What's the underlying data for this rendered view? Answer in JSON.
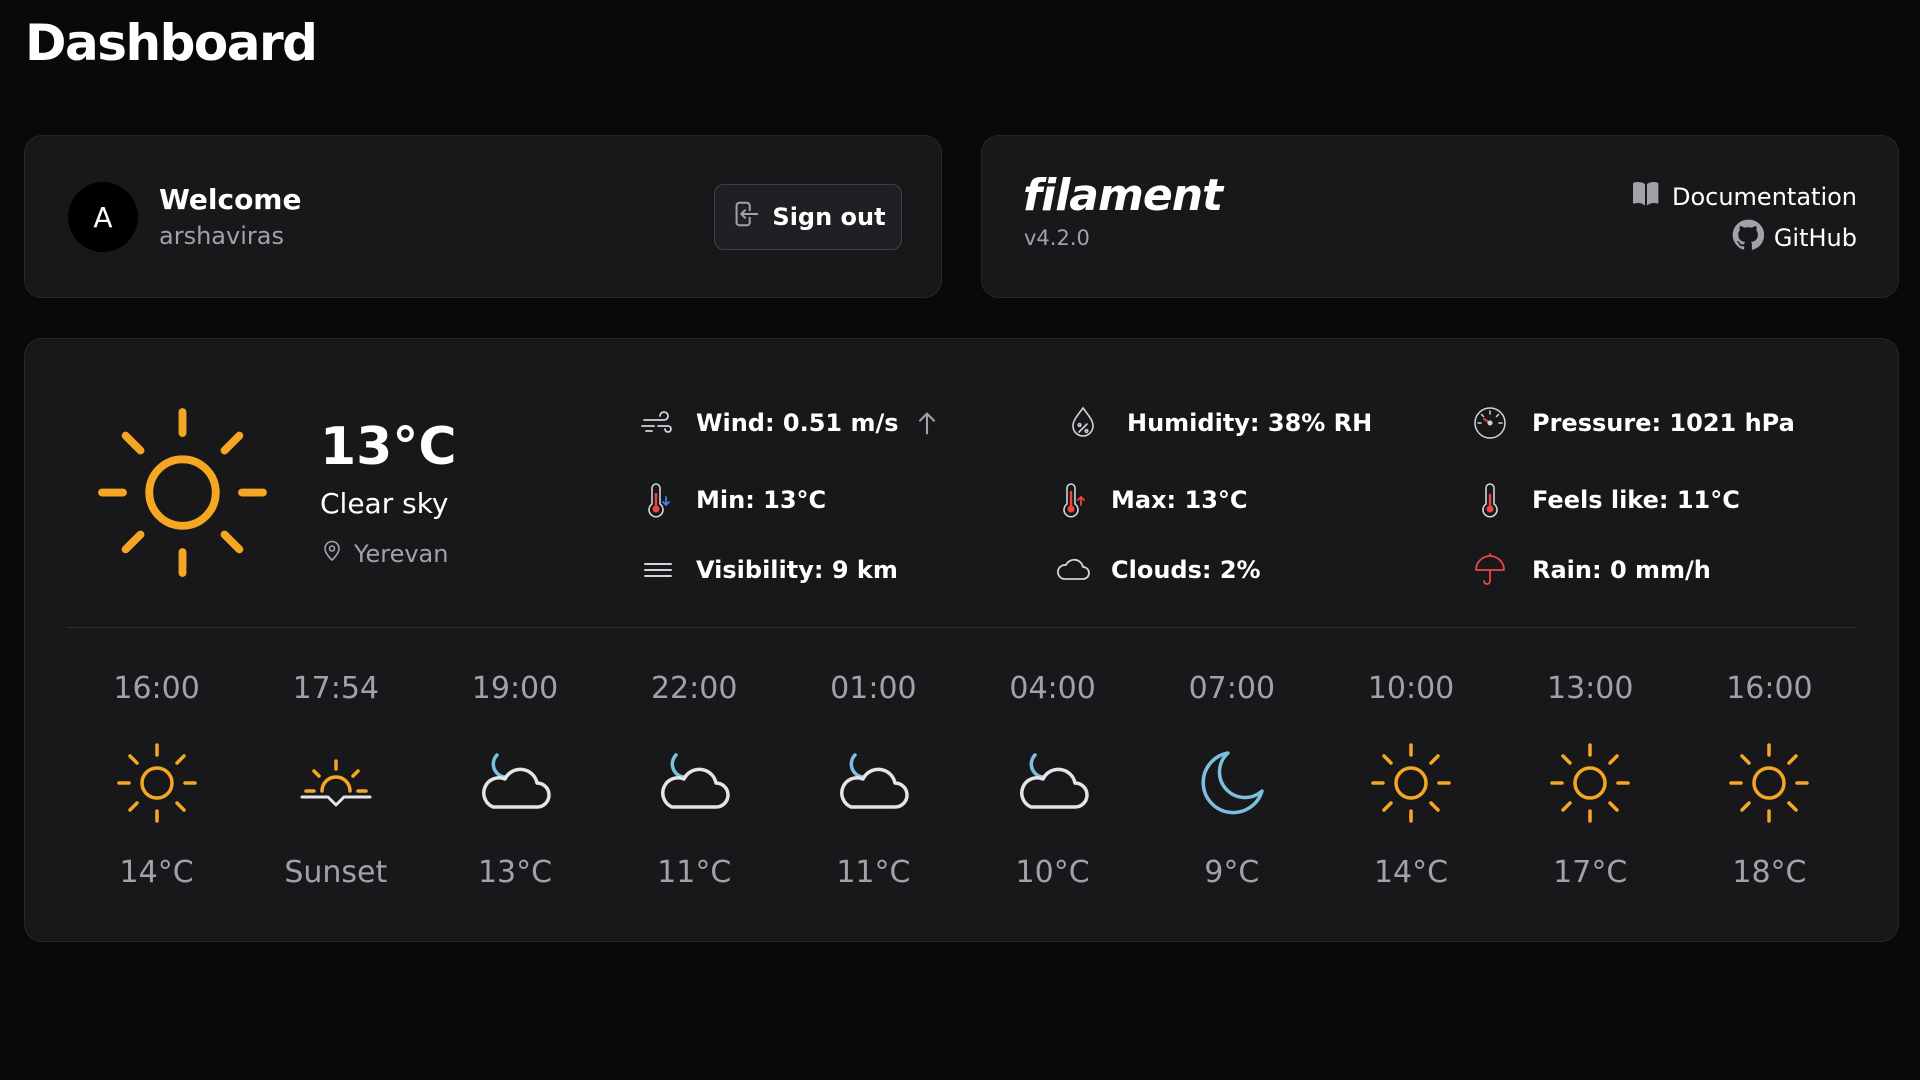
{
  "page": {
    "title": "Dashboard"
  },
  "account": {
    "avatar_initial": "A",
    "welcome_label": "Welcome",
    "username": "arshaviras",
    "signout_label": "Sign out"
  },
  "filament": {
    "brand": "filament",
    "version": "v4.2.0",
    "docs_label": "Documentation",
    "github_label": "GitHub"
  },
  "weather": {
    "temperature": "13°C",
    "condition": "Clear sky",
    "location": "Yerevan",
    "icon": "sun-icon",
    "stats": {
      "wind": "Wind: 0.51 m/s",
      "humidity": "Humidity: 38% RH",
      "pressure": "Pressure: 1021 hPa",
      "min": "Min: 13°C",
      "max": "Max: 13°C",
      "feels_like": "Feels like: 11°C",
      "visibility": "Visibility: 9 km",
      "clouds": "Clouds: 2%",
      "rain": "Rain: 0 mm/h"
    },
    "forecast": [
      {
        "time": "16:00",
        "icon": "sun-icon",
        "value": "14°C"
      },
      {
        "time": "17:54",
        "icon": "sunset-icon",
        "value": "Sunset"
      },
      {
        "time": "19:00",
        "icon": "cloudy-night-icon",
        "value": "13°C"
      },
      {
        "time": "22:00",
        "icon": "cloudy-night-icon",
        "value": "11°C"
      },
      {
        "time": "01:00",
        "icon": "cloudy-night-icon",
        "value": "11°C"
      },
      {
        "time": "04:00",
        "icon": "cloudy-night-icon",
        "value": "10°C"
      },
      {
        "time": "07:00",
        "icon": "moon-icon",
        "value": "9°C"
      },
      {
        "time": "10:00",
        "icon": "sun-icon",
        "value": "14°C"
      },
      {
        "time": "13:00",
        "icon": "sun-icon",
        "value": "17°C"
      },
      {
        "time": "16:00",
        "icon": "sun-icon",
        "value": "18°C"
      }
    ]
  },
  "colors": {
    "background": "#09090b",
    "card": "#18181b",
    "sun": "#f5a623",
    "moon": "#7cc0e0",
    "muted": "#a1a1aa"
  }
}
